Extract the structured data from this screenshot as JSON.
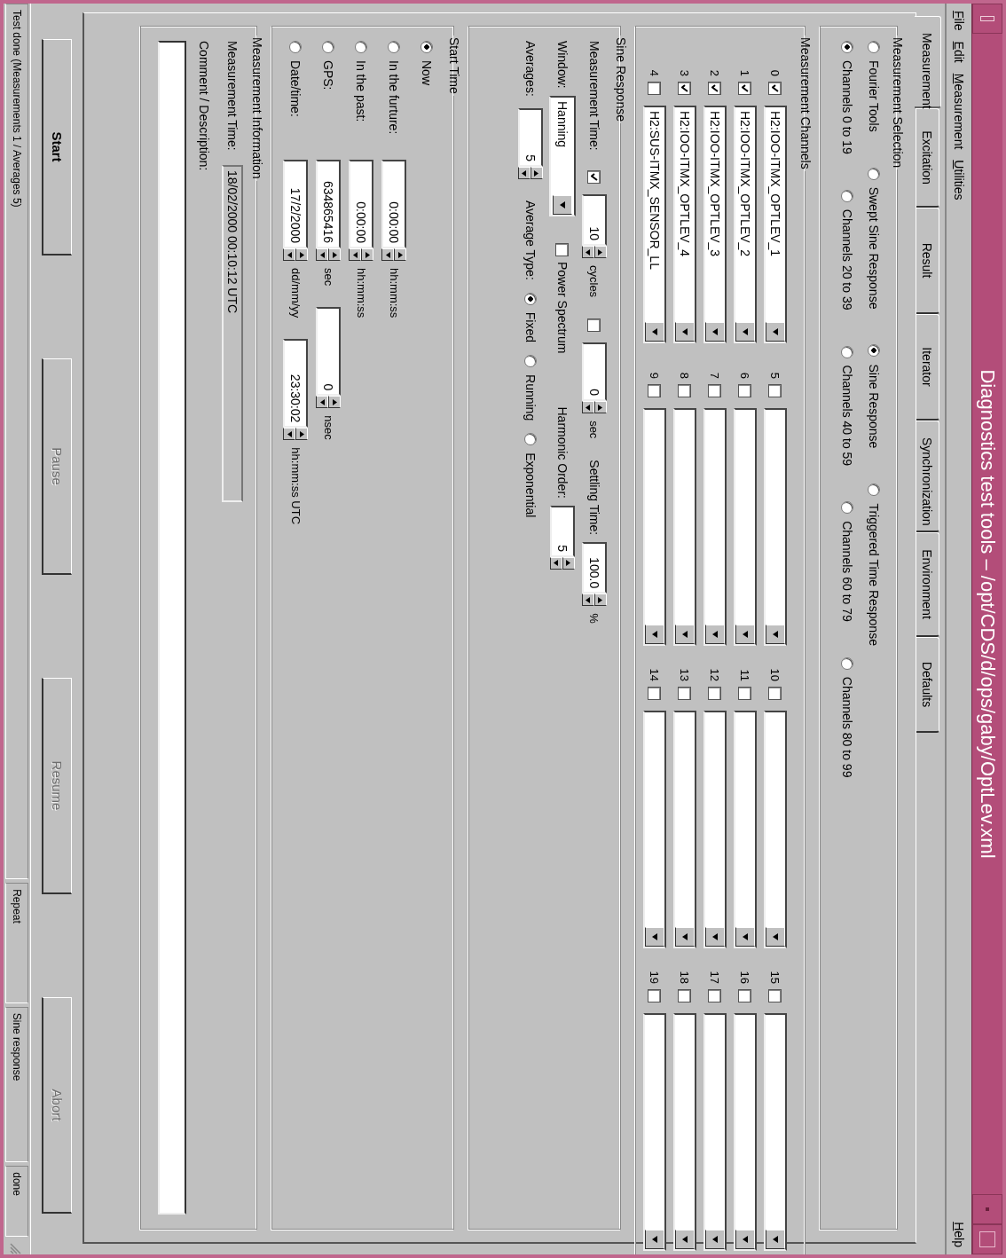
{
  "window": {
    "title": "Diagnostics test tools – /opt/CDS/d/ops/gaby/OptLev.xml"
  },
  "menu": [
    {
      "label": "File"
    },
    {
      "label": "Edit"
    },
    {
      "label": "Measurement"
    },
    {
      "label": "Utilities"
    }
  ],
  "help_menu": {
    "label": "Help"
  },
  "tabs": [
    {
      "label": "Measurement",
      "selected": true
    },
    {
      "label": "Excitation",
      "selected": false
    },
    {
      "label": "Result",
      "selected": false
    },
    {
      "label": "Iterator",
      "selected": false
    },
    {
      "label": "Synchronization",
      "selected": false
    },
    {
      "label": "Environment",
      "selected": false
    },
    {
      "label": "Defaults",
      "selected": false
    }
  ],
  "measurement_selection": {
    "title": "Measurement Selection",
    "types": [
      {
        "label": "Fourier Tools",
        "selected": false
      },
      {
        "label": "Swept Sine Response",
        "selected": false
      },
      {
        "label": "Sine Response",
        "selected": true
      },
      {
        "label": "Triggered Time Response",
        "selected": false
      }
    ],
    "channel_ranges": [
      {
        "label": "Channels 0 to 19",
        "selected": true
      },
      {
        "label": "Channels 20 to 39",
        "selected": false
      },
      {
        "label": "Channels 40 to 59",
        "selected": false
      },
      {
        "label": "Channels 60 to 79",
        "selected": false
      },
      {
        "label": "Channels 80 to 99",
        "selected": false
      }
    ]
  },
  "measurement_channels": {
    "title": "Measurement Channels",
    "channels": [
      {
        "number": "0",
        "checked": true,
        "name": "H2:IOO-ITMX_OPTLEV_1"
      },
      {
        "number": "1",
        "checked": true,
        "name": "H2:IOO-ITMX_OPTLEV_2"
      },
      {
        "number": "2",
        "checked": true,
        "name": "H2:IOO-ITMX_OPTLEV_3"
      },
      {
        "number": "3",
        "checked": true,
        "name": "H2:IOO-ITMX_OPTLEV_4"
      },
      {
        "number": "4",
        "checked": false,
        "name": "H2:SUS-ITMX_SENSOR_LL"
      },
      {
        "number": "5",
        "checked": false
      },
      {
        "number": "6",
        "checked": false
      },
      {
        "number": "7",
        "checked": false
      },
      {
        "number": "8",
        "checked": false
      },
      {
        "number": "9",
        "checked": false
      },
      {
        "number": "10",
        "checked": false
      },
      {
        "number": "11",
        "checked": false
      },
      {
        "number": "12",
        "checked": false
      },
      {
        "number": "13",
        "checked": false
      },
      {
        "number": "14",
        "checked": false
      },
      {
        "number": "15",
        "checked": false
      },
      {
        "number": "16",
        "checked": false
      },
      {
        "number": "17",
        "checked": false
      },
      {
        "number": "18",
        "checked": false
      },
      {
        "number": "19",
        "checked": false
      }
    ]
  },
  "sine_response": {
    "title": "Sine Response",
    "measurement_time": {
      "label": "Measurement Time:",
      "checked": true,
      "cycles_value": "10",
      "cycles_unit": "cycles",
      "seconds_checked": false,
      "seconds_value": "0",
      "seconds_unit": "sec"
    },
    "settling_time": {
      "label": "Settling Time:",
      "value": "100.0",
      "unit": "%"
    },
    "window": {
      "label": "Window:",
      "value": "Hanning"
    },
    "power_spectrum": {
      "label": "Power Spectrum",
      "checked": false
    },
    "harmonic_order": {
      "label": "Harmonic Order:",
      "value": "5"
    },
    "averages": {
      "label": "Averages:",
      "value": "5"
    },
    "average_type": {
      "label": "Average Type:",
      "options": [
        {
          "label": "Fixed",
          "selected": true
        },
        {
          "label": "Running",
          "selected": false
        },
        {
          "label": "Exponential",
          "selected": false
        }
      ]
    }
  },
  "start_time": {
    "title": "Start Time",
    "options": [
      {
        "label": "Now",
        "selected": true
      },
      {
        "label": "In the furture:",
        "selected": false,
        "fields": [
          {
            "value": "0:00:00",
            "unit": "hh:mm:ss"
          }
        ]
      },
      {
        "label": "In the past:",
        "selected": false,
        "fields": [
          {
            "value": "0:00:00",
            "unit": "hh:mm:ss"
          }
        ]
      },
      {
        "label": "GPS:",
        "selected": false,
        "fields": [
          {
            "value": "634865416",
            "unit": "sec"
          },
          {
            "value": "0",
            "unit": "nsec"
          }
        ]
      },
      {
        "label": "Date/time:",
        "selected": false,
        "fields": [
          {
            "value": "17/2/2000",
            "unit": "dd/mm/yy"
          },
          {
            "value": "23:30:02",
            "unit": "hh:mm:ss  UTC"
          }
        ]
      }
    ]
  },
  "measurement_information": {
    "title": "Measurement Information",
    "measurement_time": {
      "label": "Measurement Time:",
      "value": "18/02/2000 00:10:12  UTC"
    },
    "comment": {
      "label": "Comment / Description:"
    }
  },
  "buttons": [
    {
      "label": "Start",
      "disabled": false
    },
    {
      "label": "Pause",
      "disabled": true
    },
    {
      "label": "Resume",
      "disabled": true
    },
    {
      "label": "Abort",
      "disabled": true
    }
  ],
  "status_bar": [
    "Test done (Measurements 1 / Averages 5)",
    "Repeat",
    "Sine response",
    "done"
  ]
}
